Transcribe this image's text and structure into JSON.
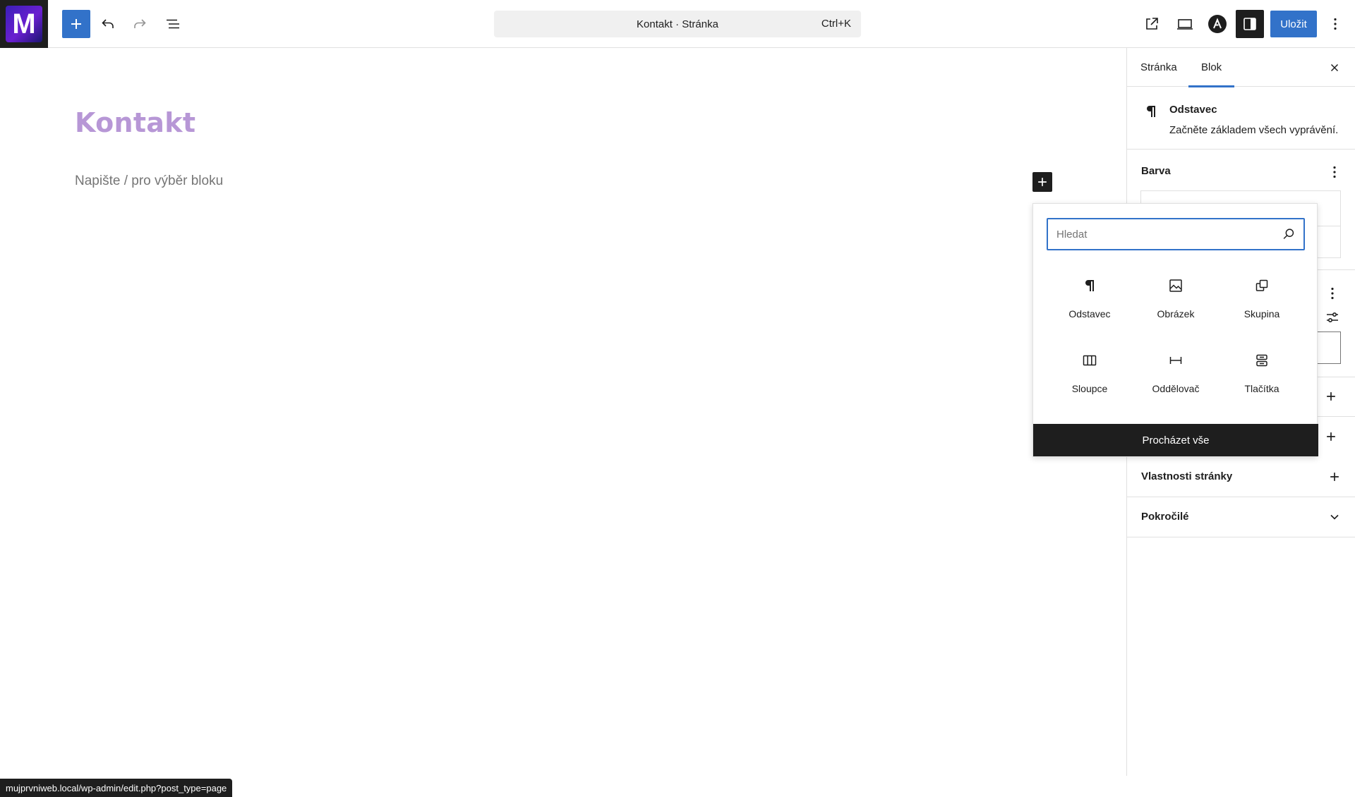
{
  "topbar": {
    "logo_letter": "M",
    "command_title": "Kontakt · Stránka",
    "command_shortcut": "Ctrl+K",
    "save_label": "Uložit"
  },
  "editor": {
    "page_title": "Kontakt",
    "placeholder": "Napište / pro výběr bloku"
  },
  "sidebar": {
    "tabs": [
      {
        "label": "Stránka"
      },
      {
        "label": "Blok"
      }
    ],
    "block": {
      "name": "Odstavec",
      "description": "Začněte základem všech vyprávění."
    },
    "panels": {
      "color": "Barva",
      "page_properties": "Vlastnosti stránky",
      "advanced": "Pokročilé"
    }
  },
  "inserter": {
    "search_placeholder": "Hledat",
    "blocks": [
      {
        "label": "Odstavec",
        "icon": "paragraph-icon"
      },
      {
        "label": "Obrázek",
        "icon": "image-icon"
      },
      {
        "label": "Skupina",
        "icon": "group-icon"
      },
      {
        "label": "Sloupce",
        "icon": "columns-icon"
      },
      {
        "label": "Oddělovač",
        "icon": "separator-icon"
      },
      {
        "label": "Tlačítka",
        "icon": "buttons-icon"
      }
    ],
    "browse_all": "Procházet vše"
  },
  "statusbar": {
    "url": "mujprvniweb.local/wp-admin/edit.php?post_type=page"
  },
  "colors": {
    "accent": "#3272c9",
    "title": "#b797d6",
    "dark": "#1e1e1e"
  }
}
